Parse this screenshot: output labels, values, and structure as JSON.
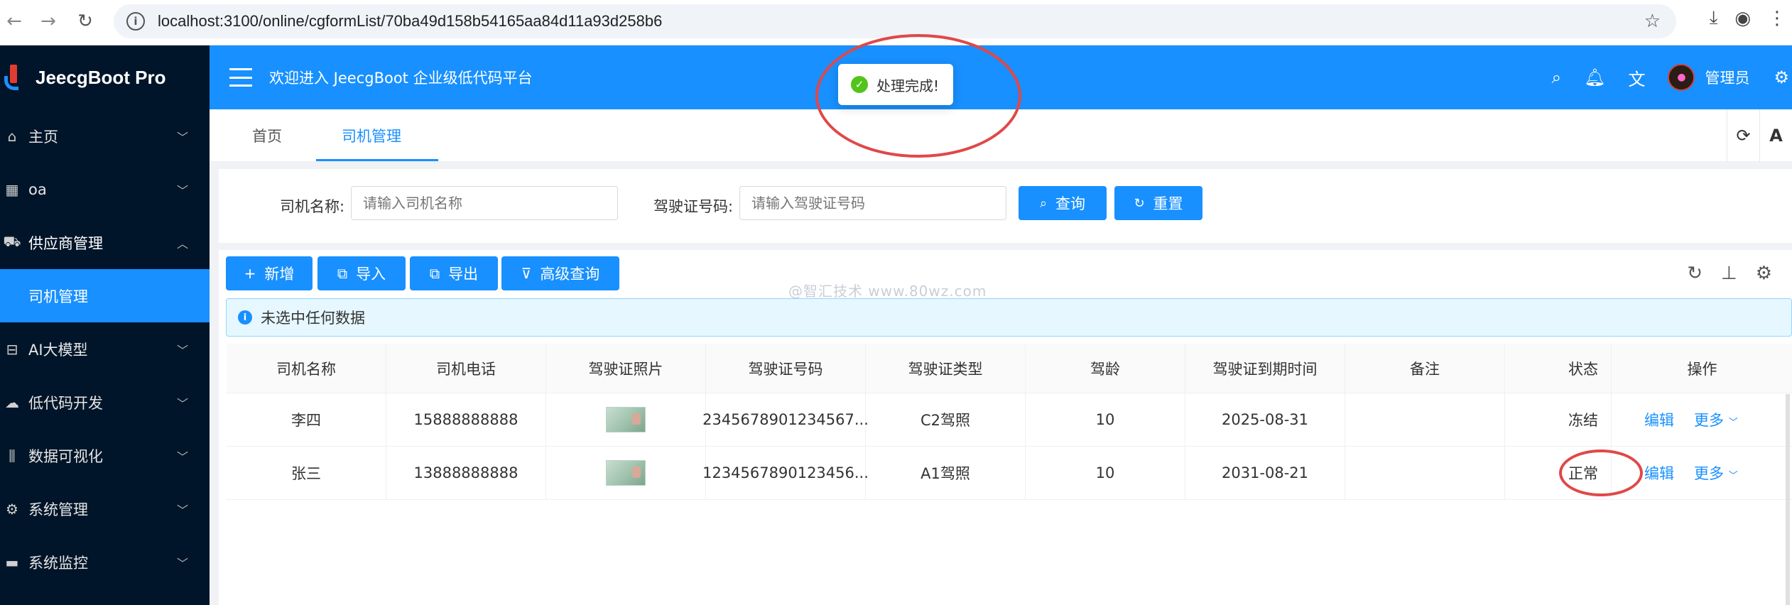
{
  "browser": {
    "url": "localhost:3100/online/cgformList/70ba49d158b54165aa84d11a93d258b6"
  },
  "sidebar": {
    "logo_text": "JeecgBoot Pro",
    "items": [
      {
        "label": "主页",
        "icon": "home-icon",
        "state": "collapsed"
      },
      {
        "label": "oa",
        "icon": "grid-icon",
        "state": "collapsed"
      },
      {
        "label": "供应商管理",
        "icon": "supplier-icon",
        "state": "expanded"
      },
      {
        "label": "司机管理",
        "icon": "",
        "state": "selected"
      },
      {
        "label": "AI大模型",
        "icon": "ai-icon",
        "state": "collapsed"
      },
      {
        "label": "低代码开发",
        "icon": "cloud-icon",
        "state": "collapsed"
      },
      {
        "label": "数据可视化",
        "icon": "chart-icon",
        "state": "collapsed"
      },
      {
        "label": "系统管理",
        "icon": "gear-icon",
        "state": "collapsed"
      },
      {
        "label": "系统监控",
        "icon": "monitor-icon",
        "state": "collapsed"
      }
    ]
  },
  "header": {
    "welcome": "欢迎进入 JeecgBoot 企业级低代码平台",
    "user_name": "管理员"
  },
  "toast": {
    "message": "处理完成!"
  },
  "tabs": [
    {
      "label": "首页",
      "active": false
    },
    {
      "label": "司机管理",
      "active": true
    }
  ],
  "tab_tool_letter": "A",
  "search": {
    "driver_name_label": "司机名称:",
    "driver_name_placeholder": "请输入司机名称",
    "license_label": "驾驶证号码:",
    "license_placeholder": "请输入驾驶证号码",
    "query_label": "查询",
    "reset_label": "重置"
  },
  "toolbar": {
    "add_label": "新增",
    "import_label": "导入",
    "export_label": "导出",
    "advanced_label": "高级查询"
  },
  "watermark": "@智汇技术 www.80wz.com",
  "alert": {
    "text": "未选中任何数据"
  },
  "table": {
    "columns": [
      "司机名称",
      "司机电话",
      "驾驶证照片",
      "驾驶证号码",
      "驾驶证类型",
      "驾龄",
      "驾驶证到期时间",
      "备注",
      "状态",
      "操作"
    ],
    "rows": [
      {
        "name": "李四",
        "phone": "15888888888",
        "license_no": "2345678901234567...",
        "license_type": "C2驾照",
        "years": "10",
        "expire": "2025-08-31",
        "remark": "",
        "status": "冻结"
      },
      {
        "name": "张三",
        "phone": "13888888888",
        "license_no": "1234567890123456...",
        "license_type": "A1驾照",
        "years": "10",
        "expire": "2031-08-21",
        "remark": "",
        "status": "正常"
      }
    ],
    "edit_label": "编辑",
    "more_label": "更多"
  },
  "colors": {
    "primary": "#1890ff",
    "sidebar_bg": "#001529",
    "annotation": "#e04848"
  }
}
